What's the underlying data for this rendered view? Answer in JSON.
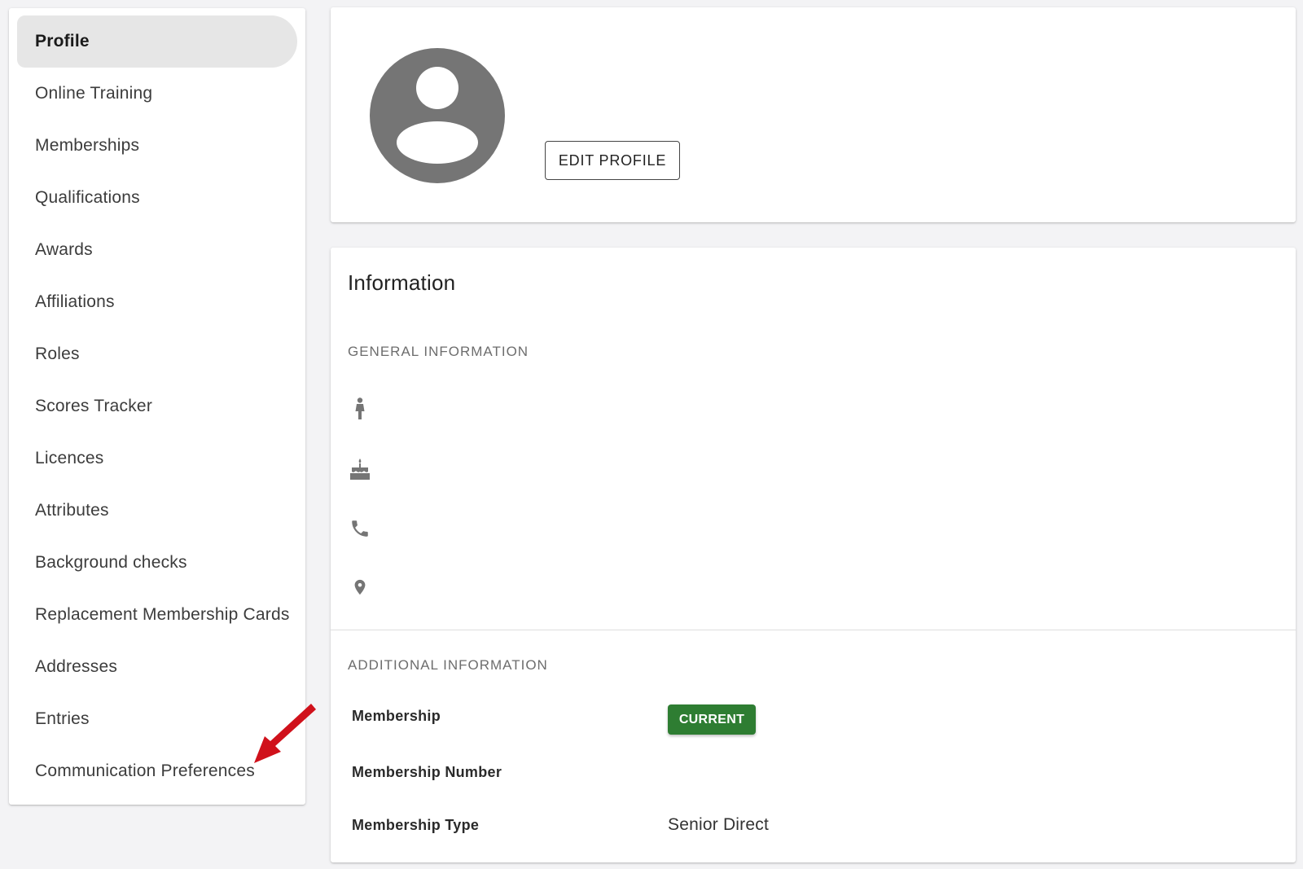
{
  "sidebar": {
    "items": [
      {
        "label": "Profile",
        "active": true
      },
      {
        "label": "Online Training"
      },
      {
        "label": "Memberships"
      },
      {
        "label": "Qualifications"
      },
      {
        "label": "Awards"
      },
      {
        "label": "Affiliations"
      },
      {
        "label": "Roles"
      },
      {
        "label": "Scores Tracker"
      },
      {
        "label": "Licences"
      },
      {
        "label": "Attributes"
      },
      {
        "label": "Background checks"
      },
      {
        "label": "Replacement Membership Cards"
      },
      {
        "label": "Addresses"
      },
      {
        "label": "Entries"
      },
      {
        "label": "Communication Preferences"
      }
    ]
  },
  "profile": {
    "edit_button": "EDIT PROFILE"
  },
  "information": {
    "title": "Information",
    "general_label": "GENERAL INFORMATION",
    "general_icons": [
      "person-icon",
      "birthday-cake-icon",
      "phone-icon",
      "location-pin-icon"
    ],
    "additional_label": "ADDITIONAL INFORMATION",
    "fields": {
      "membership": {
        "label": "Membership",
        "badge": "CURRENT",
        "badge_color": "#2e7d32"
      },
      "membership_number": {
        "label": "Membership Number",
        "value": ""
      },
      "membership_type": {
        "label": "Membership Type",
        "value": "Senior Direct"
      }
    }
  },
  "colors": {
    "background": "#f3f3f5",
    "active_nav": "#e6e6e6",
    "icon_gray": "#757575",
    "annotation_arrow": "#d0111b"
  }
}
